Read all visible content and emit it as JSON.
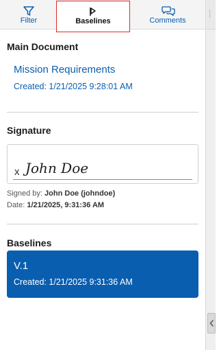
{
  "tabs": {
    "filter": {
      "label": "Filter",
      "icon": "filter-icon"
    },
    "baselines": {
      "label": "Baselines",
      "icon": "baseline-flag-icon",
      "active": true
    },
    "comments": {
      "label": "Comments",
      "icon": "comments-icon"
    }
  },
  "main_document": {
    "heading": "Main Document",
    "title": "Mission Requirements",
    "created": "Created: 1/21/2025 9:28:01 AM"
  },
  "signature": {
    "heading": "Signature",
    "mark": "x",
    "signed_name": "John Doe",
    "signed_by_label": "Signed by:",
    "signed_by_value": "John Doe (johndoe)",
    "date_label": "Date:",
    "date_value": "1/21/2025, 9:31:36 AM"
  },
  "baselines": {
    "heading": "Baselines",
    "items": [
      {
        "version": "V.1",
        "created": "Created: 1/21/2025 9:31:36 AM",
        "selected": true
      }
    ]
  },
  "colors": {
    "accent": "#0a5eaf",
    "highlight_border": "#d92b2b"
  }
}
